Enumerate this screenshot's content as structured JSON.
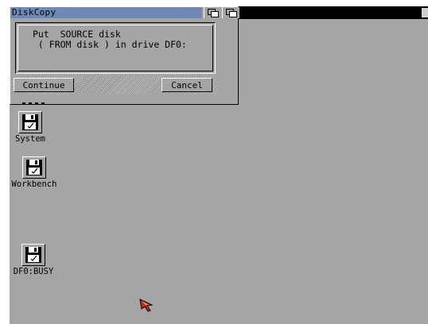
{
  "window": {
    "title": "DiskCopy",
    "message_line1": "Put  SOURCE disk",
    "message_line2": " ( FROM disk ) in drive DF0:",
    "continue_label": "Continue",
    "cancel_label": "Cancel"
  },
  "desktop": {
    "background_color": "#a5a5a5",
    "title_color": "#6d89b4",
    "icons": [
      {
        "label": "System",
        "icon": "floppy-disk-icon"
      },
      {
        "label": "Workbench",
        "icon": "floppy-disk-icon"
      },
      {
        "label": "DF0:BUSY",
        "icon": "floppy-disk-icon"
      }
    ]
  },
  "pointer": {
    "icon": "mouse-pointer-icon",
    "color": "#cc2a1f"
  }
}
